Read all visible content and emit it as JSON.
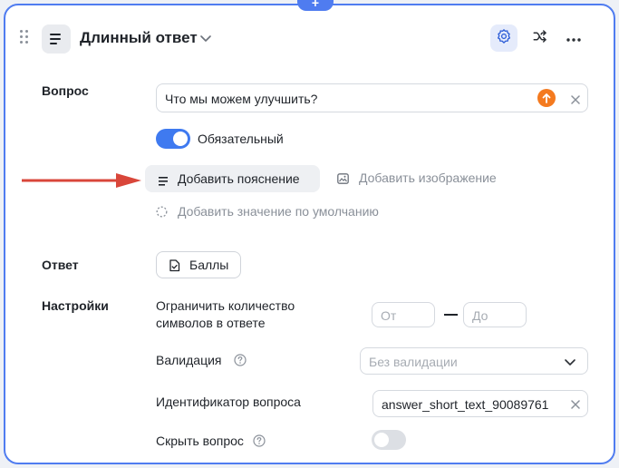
{
  "header": {
    "title": "Длинный ответ",
    "type_icon": "align-left-icon",
    "actions": [
      "gear-icon",
      "shuffle-icon",
      "more-icon"
    ]
  },
  "question": {
    "section_label": "Вопрос",
    "input_value": "Что мы можем улучшить?",
    "required_toggle": {
      "label": "Обязательный",
      "on": true
    },
    "add_hint_label": "Добавить пояснение",
    "add_image_label": "Добавить изображение",
    "add_default_label": "Добавить значение по умолчанию"
  },
  "answer": {
    "section_label": "Ответ",
    "points_button_label": "Баллы"
  },
  "settings": {
    "section_label": "Настройки",
    "limit_label_line1": "Ограничить количество",
    "limit_label_line2": "символов в ответе",
    "from_placeholder": "От",
    "to_placeholder": "До",
    "validation_label": "Валидация",
    "validation_placeholder": "Без валидации",
    "identifier_label": "Идентификатор вопроса",
    "identifier_value": "answer_short_text_90089761",
    "hide_label": "Скрыть вопрос",
    "hide_on": false
  },
  "colors": {
    "accent": "#4f7cf0",
    "toggle_on": "#3f7af0",
    "annotation_arrow": "#d9463a",
    "orange_badge": "#f47a1f"
  }
}
